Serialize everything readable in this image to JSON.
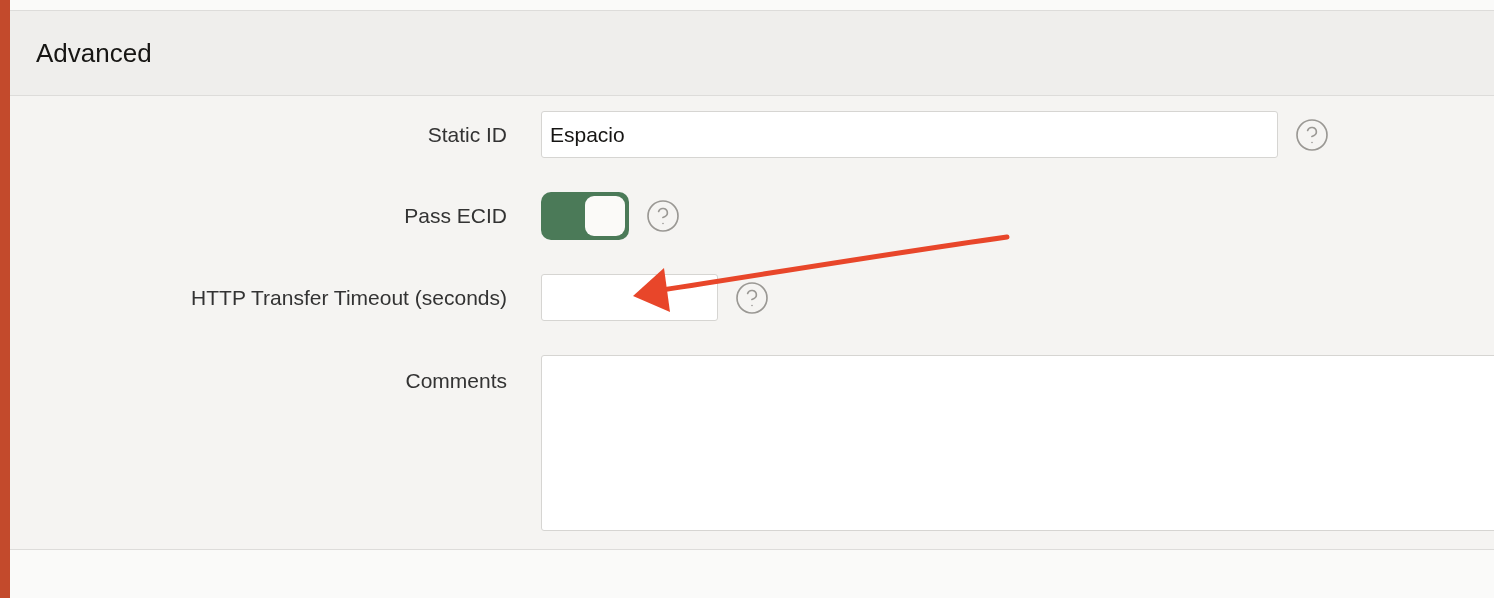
{
  "section": {
    "title": "Advanced"
  },
  "fields": [
    {
      "kind": "text",
      "label": "Static ID",
      "value": "Espacio"
    },
    {
      "kind": "switch",
      "label": "Pass ECID",
      "on": true
    },
    {
      "kind": "number",
      "label": "HTTP Transfer Timeout (seconds)"
    },
    {
      "kind": "textarea",
      "label": "Comments"
    }
  ]
}
